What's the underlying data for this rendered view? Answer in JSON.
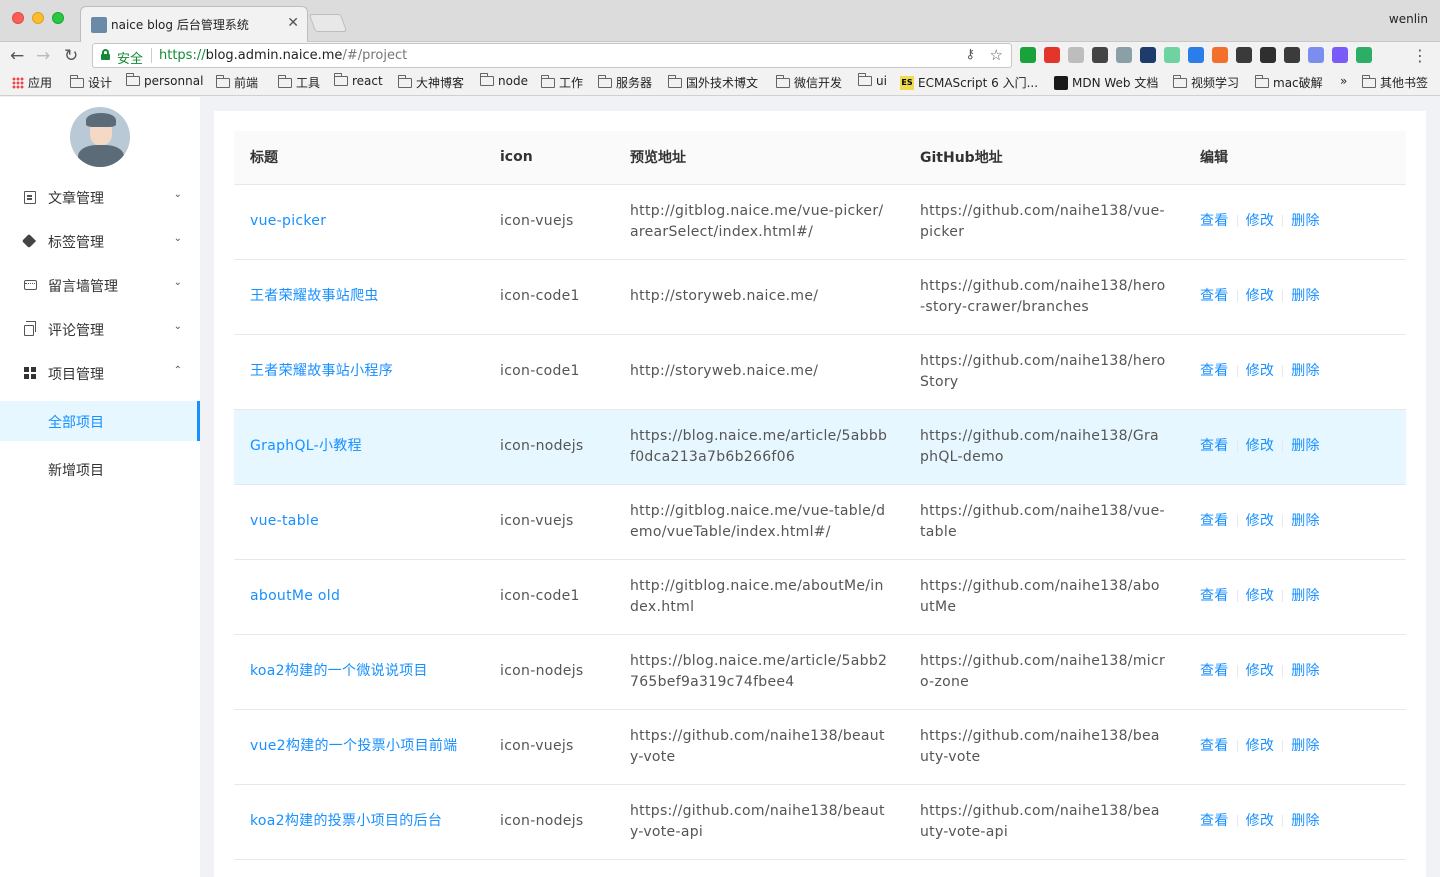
{
  "browser": {
    "tab_title": "naice blog 后台管理系统",
    "user": "wenlin",
    "secure_label": "安全",
    "url_proto": "https://",
    "url_host": "blog.admin.naice.me",
    "url_path": "/#/project",
    "bookmarks": [
      "应用",
      "设计",
      "personnal",
      "前端",
      "工具",
      "react",
      "大神博客",
      "node",
      "工作",
      "服务器",
      "国外技术博文",
      "微信开发",
      "ui",
      "ECMAScript 6 入门...",
      "MDN Web 文档",
      "视频学习",
      "mac破解",
      "»",
      "其他书签"
    ],
    "extension_colors": [
      "#1aa33b",
      "#e4352b",
      "#bdbdbd",
      "#444444",
      "#8aa0a6",
      "#1d3c6b",
      "#6fd3a1",
      "#2b7de9",
      "#f2702c",
      "#3a3a3a",
      "#2f2f2f",
      "#3b3b3b",
      "#7b8ef0",
      "#7a5af8",
      "#2cae66"
    ]
  },
  "sidebar": {
    "menus": [
      {
        "label": "文章管理",
        "icon": "document-icon",
        "expanded": false
      },
      {
        "label": "标签管理",
        "icon": "tag-icon",
        "expanded": false
      },
      {
        "label": "留言墙管理",
        "icon": "message-icon",
        "expanded": false
      },
      {
        "label": "评论管理",
        "icon": "copy-icon",
        "expanded": false
      },
      {
        "label": "项目管理",
        "icon": "appstore-icon",
        "expanded": true
      }
    ],
    "sub_items": [
      {
        "label": "全部项目",
        "active": true
      },
      {
        "label": "新增项目",
        "active": false
      }
    ]
  },
  "table": {
    "columns": [
      "标题",
      "icon",
      "预览地址",
      "GitHub地址",
      "编辑"
    ],
    "actions": [
      "查看",
      "修改",
      "删除"
    ],
    "rows": [
      {
        "title": "vue-picker",
        "icon": "icon-vuejs",
        "preview": "http://gitblog.naice.me/vue-picker/arearSelect/index.html#/",
        "github": "https://github.com/naihe138/vue-picker"
      },
      {
        "title": "王者荣耀故事站爬虫",
        "icon": "icon-code1",
        "preview": "http://storyweb.naice.me/",
        "github": "https://github.com/naihe138/hero-story-crawer/branches"
      },
      {
        "title": "王者荣耀故事站小程序",
        "icon": "icon-code1",
        "preview": "http://storyweb.naice.me/",
        "github": "https://github.com/naihe138/heroStory"
      },
      {
        "title": "GraphQL-小教程",
        "icon": "icon-nodejs",
        "preview": "https://blog.naice.me/article/5abbbf0dca213a7b6b266f06",
        "github": "https://github.com/naihe138/GraphQL-demo"
      },
      {
        "title": "vue-table",
        "icon": "icon-vuejs",
        "preview": "http://gitblog.naice.me/vue-table/demo/vueTable/index.html#/",
        "github": "https://github.com/naihe138/vue-table"
      },
      {
        "title": "aboutMe old",
        "icon": "icon-code1",
        "preview": "http://gitblog.naice.me/aboutMe/index.html",
        "github": "https://github.com/naihe138/aboutMe"
      },
      {
        "title": "koa2构建的一个微说说项目",
        "icon": "icon-nodejs",
        "preview": "https://blog.naice.me/article/5abb2765bef9a319c74fbee4",
        "github": "https://github.com/naihe138/micro-zone"
      },
      {
        "title": "vue2构建的一个投票小项目前端",
        "icon": "icon-vuejs",
        "preview": "https://github.com/naihe138/beauty-vote",
        "github": "https://github.com/naihe138/beauty-vote"
      },
      {
        "title": "koa2构建的投票小项目的后台",
        "icon": "icon-nodejs",
        "preview": "https://github.com/naihe138/beauty-vote-api",
        "github": "https://github.com/naihe138/beauty-vote-api"
      }
    ]
  }
}
